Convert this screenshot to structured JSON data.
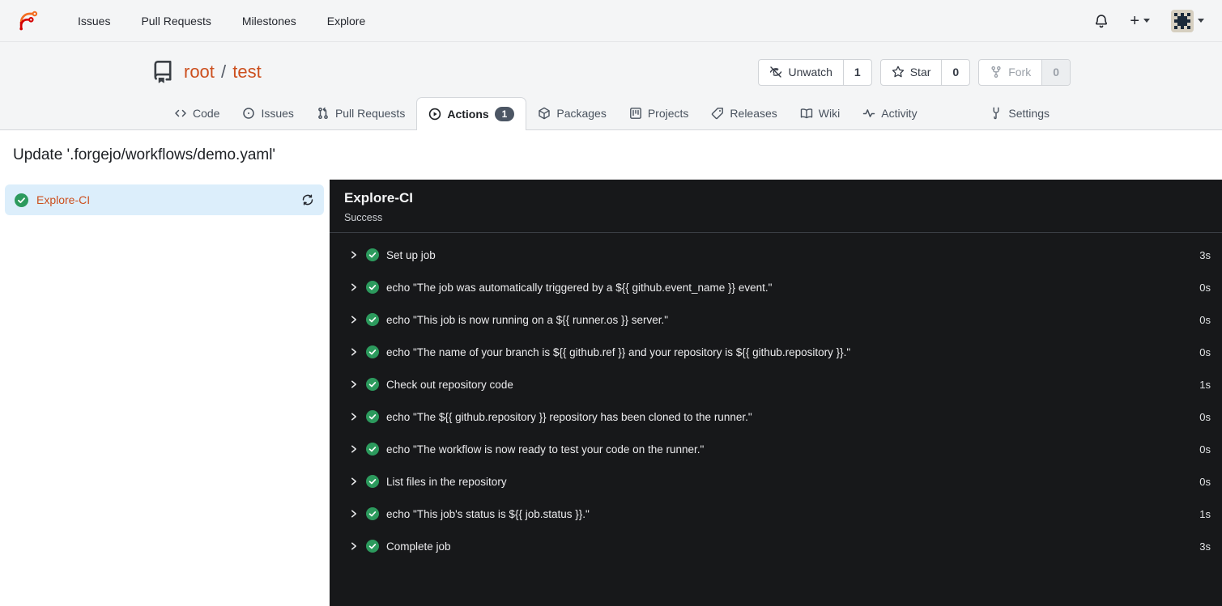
{
  "navbar": {
    "items": [
      {
        "label": "Issues"
      },
      {
        "label": "Pull Requests"
      },
      {
        "label": "Milestones"
      },
      {
        "label": "Explore"
      }
    ]
  },
  "repo": {
    "owner": "root",
    "separator": "/",
    "name": "test",
    "actions": [
      {
        "label": "Unwatch",
        "count": "1"
      },
      {
        "label": "Star",
        "count": "0"
      },
      {
        "label": "Fork",
        "count": "0",
        "disabled": true
      }
    ]
  },
  "tabs": [
    {
      "label": "Code"
    },
    {
      "label": "Issues"
    },
    {
      "label": "Pull Requests"
    },
    {
      "label": "Actions",
      "badge": "1",
      "active": true
    },
    {
      "label": "Packages"
    },
    {
      "label": "Projects"
    },
    {
      "label": "Releases"
    },
    {
      "label": "Wiki"
    },
    {
      "label": "Activity"
    },
    {
      "label": "Settings"
    }
  ],
  "page": {
    "title": "Update '.forgejo/workflows/demo.yaml'"
  },
  "sidebar": {
    "jobs": [
      {
        "name": "Explore-CI",
        "status": "success"
      }
    ]
  },
  "panel": {
    "title": "Explore-CI",
    "status": "Success",
    "steps": [
      {
        "name": "Set up job",
        "duration": "3s"
      },
      {
        "name": "echo \"The job was automatically triggered by a ${{ github.event_name }} event.\"",
        "duration": "0s"
      },
      {
        "name": "echo \"This job is now running on a ${{ runner.os }} server.\"",
        "duration": "0s"
      },
      {
        "name": "echo \"The name of your branch is ${{ github.ref }} and your repository is ${{ github.repository }}.\"",
        "duration": "0s"
      },
      {
        "name": "Check out repository code",
        "duration": "1s"
      },
      {
        "name": "echo \"The ${{ github.repository }} repository has been cloned to the runner.\"",
        "duration": "0s"
      },
      {
        "name": "echo \"The workflow is now ready to test your code on the runner.\"",
        "duration": "0s"
      },
      {
        "name": "List files in the repository",
        "duration": "0s"
      },
      {
        "name": "echo \"This job's status is ${{ job.status }}.\"",
        "duration": "1s"
      },
      {
        "name": "Complete job",
        "duration": "3s"
      }
    ]
  },
  "colors": {
    "accent_orange": "#cc4f1e",
    "success_green": "#2c9a5d",
    "selected_blue": "#dceefb",
    "panel_dark": "#17181a",
    "header_gray": "#f4f5f6",
    "badge_gray": "#4c5664"
  }
}
